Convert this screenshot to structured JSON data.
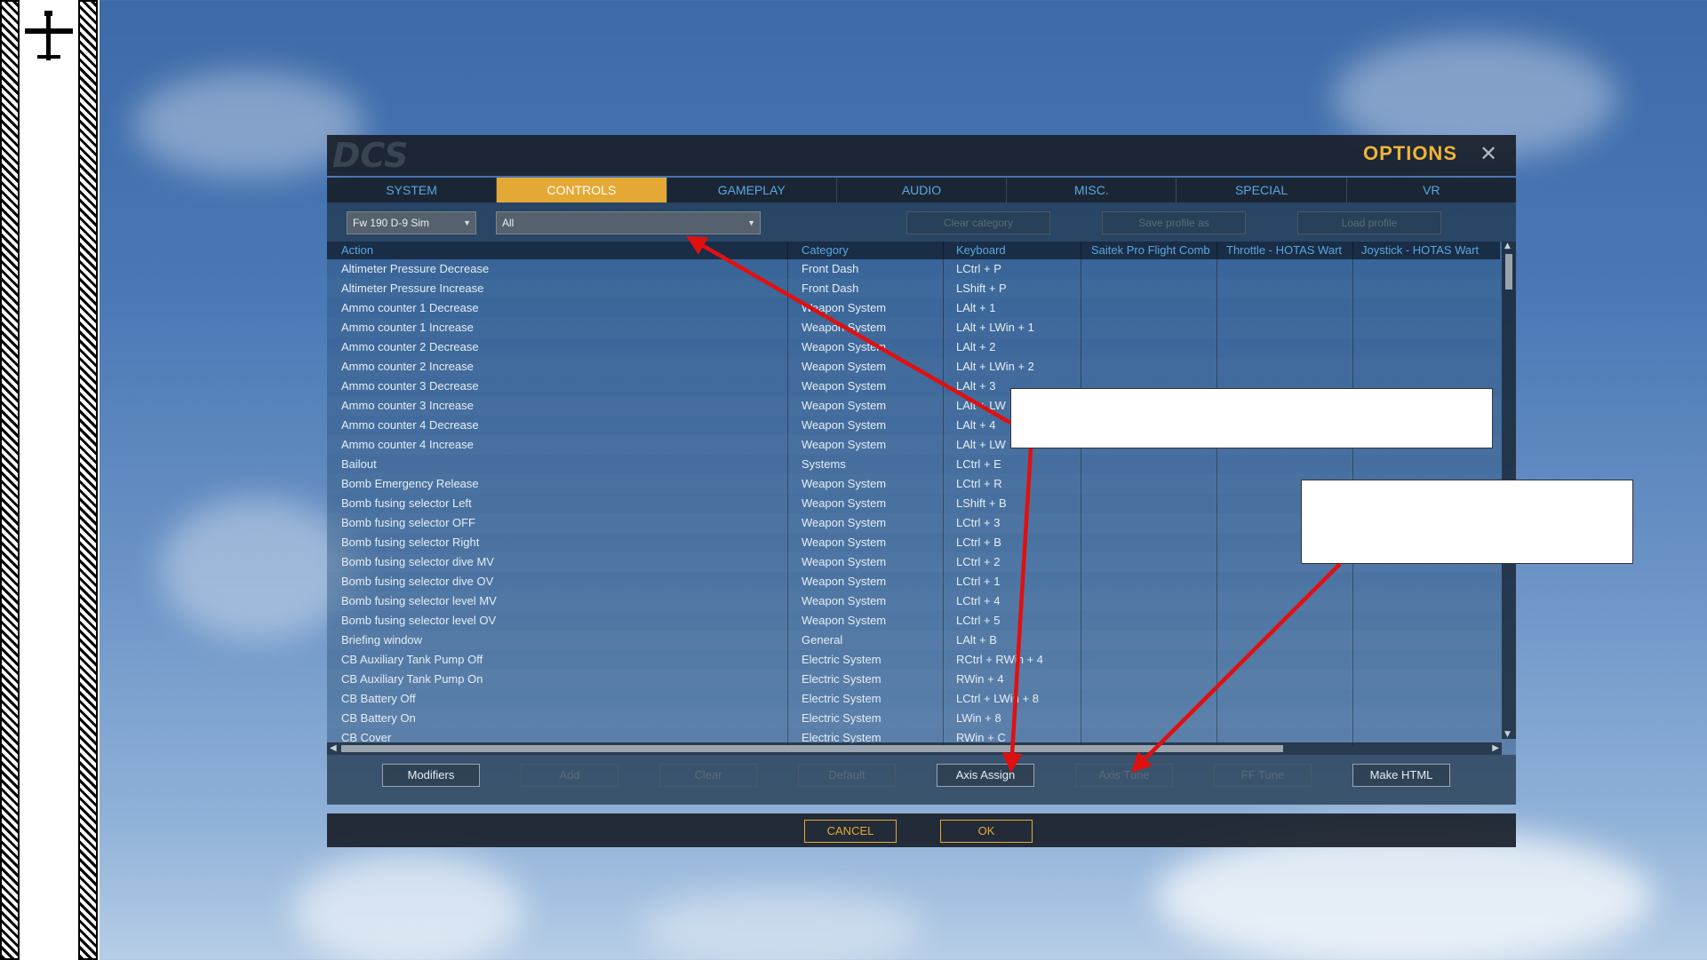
{
  "window": {
    "title": "OPTIONS",
    "logo_text": "DCS"
  },
  "tabs": [
    {
      "label": "SYSTEM",
      "active": false
    },
    {
      "label": "CONTROLS",
      "active": true
    },
    {
      "label": "GAMEPLAY",
      "active": false
    },
    {
      "label": "AUDIO",
      "active": false
    },
    {
      "label": "MISC.",
      "active": false
    },
    {
      "label": "SPECIAL",
      "active": false
    },
    {
      "label": "VR",
      "active": false
    }
  ],
  "toolbar": {
    "aircraft_select": "Fw 190 D-9 Sim",
    "category_filter": "All",
    "clear_category": "Clear category",
    "save_profile_as": "Save profile as",
    "load_profile": "Load profile"
  },
  "table": {
    "headers": [
      "Action",
      "Category",
      "Keyboard",
      "Saitek Pro Flight Comb",
      "Throttle - HOTAS Wart",
      "Joystick - HOTAS Wart"
    ],
    "rows": [
      [
        "Altimeter Pressure Decrease",
        "Front Dash",
        "LCtrl + P"
      ],
      [
        "Altimeter Pressure Increase",
        "Front Dash",
        "LShift + P"
      ],
      [
        "Ammo counter 1 Decrease",
        "Weapon System",
        "LAlt + 1"
      ],
      [
        "Ammo counter 1 Increase",
        "Weapon System",
        "LAlt + LWin + 1"
      ],
      [
        "Ammo counter 2 Decrease",
        "Weapon System",
        "LAlt + 2"
      ],
      [
        "Ammo counter 2 Increase",
        "Weapon System",
        "LAlt + LWin + 2"
      ],
      [
        "Ammo counter 3 Decrease",
        "Weapon System",
        "LAlt + 3"
      ],
      [
        "Ammo counter 3 Increase",
        "Weapon System",
        "LAlt + LW"
      ],
      [
        "Ammo counter 4 Decrease",
        "Weapon System",
        "LAlt + 4"
      ],
      [
        "Ammo counter 4 Increase",
        "Weapon System",
        "LAlt + LW"
      ],
      [
        "Bailout",
        "Systems",
        "LCtrl + E"
      ],
      [
        "Bomb Emergency Release",
        "Weapon System",
        "LCtrl + R"
      ],
      [
        "Bomb fusing selector Left",
        "Weapon System",
        "LShift + B"
      ],
      [
        "Bomb fusing selector OFF",
        "Weapon System",
        "LCtrl + 3"
      ],
      [
        "Bomb fusing selector Right",
        "Weapon System",
        "LCtrl + B"
      ],
      [
        "Bomb fusing selector dive MV",
        "Weapon System",
        "LCtrl + 2"
      ],
      [
        "Bomb fusing selector dive OV",
        "Weapon System",
        "LCtrl + 1"
      ],
      [
        "Bomb fusing selector level MV",
        "Weapon System",
        "LCtrl + 4"
      ],
      [
        "Bomb fusing selector level OV",
        "Weapon System",
        "LCtrl + 5"
      ],
      [
        "Briefing window",
        "General",
        "LAlt + B"
      ],
      [
        "CB Auxiliary Tank Pump Off",
        "Electric System",
        "RCtrl + RWin + 4"
      ],
      [
        "CB Auxiliary Tank Pump On",
        "Electric System",
        "RWin + 4"
      ],
      [
        "CB Battery Off",
        "Electric System",
        "LCtrl + LWin + 8"
      ],
      [
        "CB Battery On",
        "Electric System",
        "LWin + 8"
      ],
      [
        "CB Cover",
        "Electric System",
        "RWin + C"
      ]
    ]
  },
  "bottom_buttons": [
    {
      "label": "Modifiers",
      "enabled": true
    },
    {
      "label": "Add",
      "enabled": false
    },
    {
      "label": "Clear",
      "enabled": false
    },
    {
      "label": "Default",
      "enabled": false
    },
    {
      "label": "Axis Assign",
      "enabled": true
    },
    {
      "label": "Axis Tune",
      "enabled": false
    },
    {
      "label": "FF Tune",
      "enabled": false
    },
    {
      "label": "Make HTML",
      "enabled": true
    }
  ],
  "footer": {
    "cancel": "CANCEL",
    "ok": "OK"
  },
  "colors": {
    "accent": "#e4a935",
    "header_text": "#5aa7e0",
    "annotation_arrow": "#e01010"
  },
  "icons": [
    "airplane-icon",
    "close-icon",
    "dropdown-caret-icon",
    "scroll-arrow-icon"
  ]
}
